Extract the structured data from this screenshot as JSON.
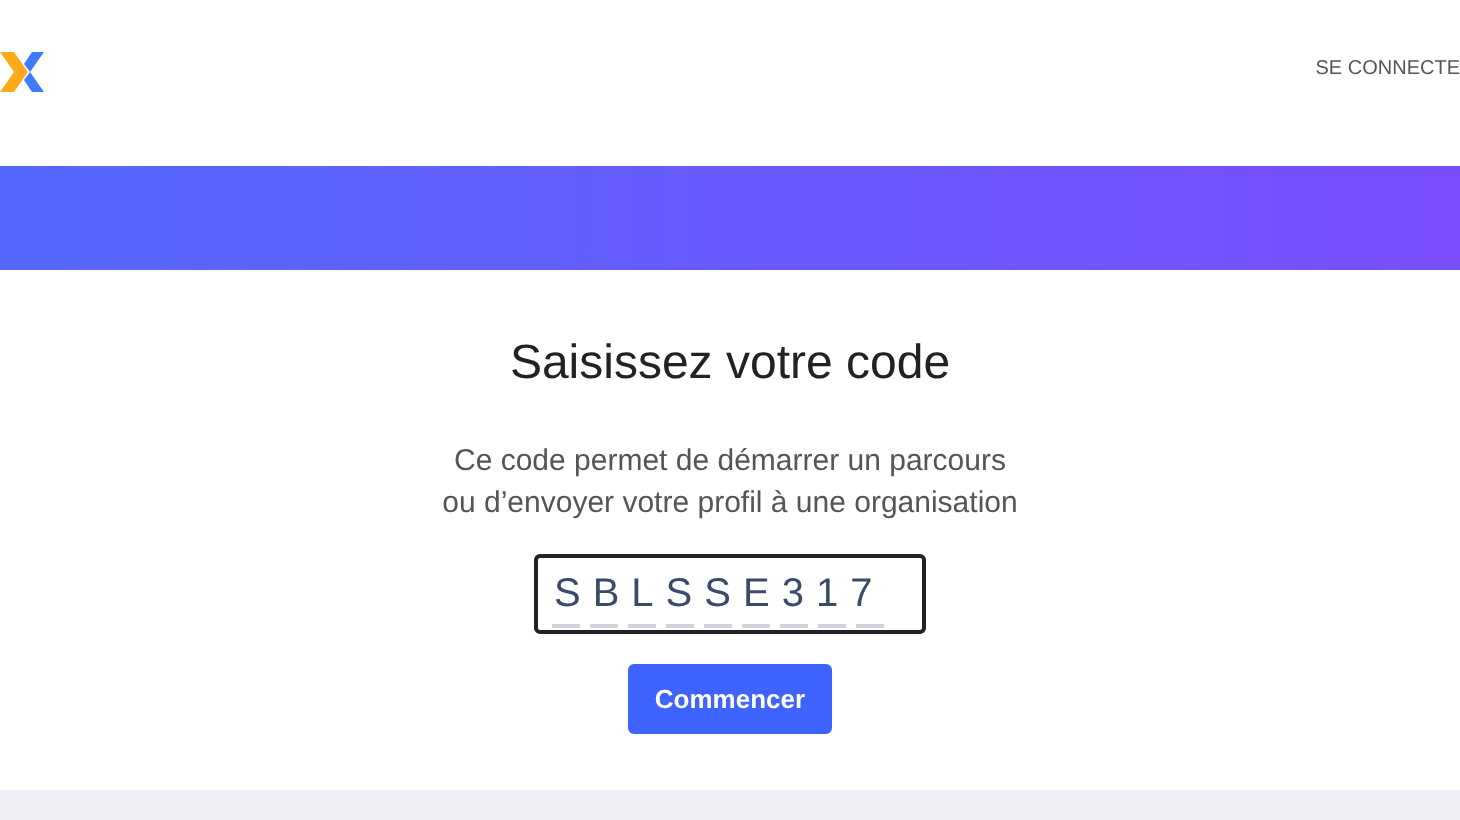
{
  "header": {
    "login_link": "SE CONNECTE"
  },
  "main": {
    "title": "Saisissez votre code",
    "description_lines": [
      "Ce code permet de démarrer un parcours",
      "ou d’envoyer votre profil à une organisation"
    ],
    "code": {
      "value": "SBLSSE317"
    },
    "submit_button": "Commencer"
  }
}
